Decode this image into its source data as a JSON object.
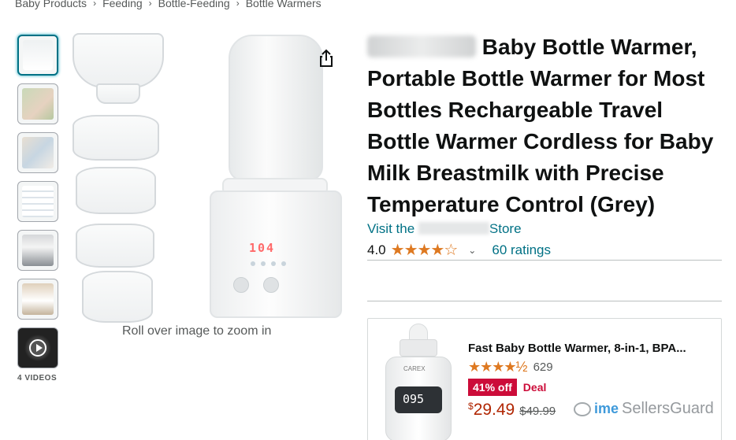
{
  "breadcrumb": [
    "Baby Products",
    "Feeding",
    "Bottle-Feeding",
    "Bottle Warmers"
  ],
  "breadcrumb_sep": "›",
  "thumbnails": [
    "product-main",
    "lifestyle-family",
    "lifestyle-mother",
    "feature-chart",
    "comparison-table",
    "lifestyle-kitchen",
    "video"
  ],
  "videos_label": "4 VIDEOS",
  "zoom_hint": "Roll over image to zoom in",
  "main_image": {
    "display_value": "104"
  },
  "product": {
    "title_rest": "Baby Bottle Warmer, Portable Bottle Warmer for Most Bottles Rechargeable Travel Bottle Warmer Cordless for Baby Milk Breastmilk with Precise Temperature Control (Grey)",
    "store_prefix": "Visit the",
    "store_suffix": "Store",
    "rating_value": "4.0",
    "stars": "★★★★☆",
    "ratings_link": "60 ratings"
  },
  "sponsored": {
    "title": "Fast Baby Bottle Warmer, 8-in-1, BPA...",
    "stars": "★★★★½",
    "rating_count": "629",
    "brand_on_image": "CAREX",
    "screen_value": "095",
    "deal_badge": "41% off",
    "deal_label": "Deal",
    "price_symbol": "$",
    "price": "29.49",
    "list_price": "$49.99",
    "prime_fragment": "ime"
  },
  "watermark": "SellersGuard",
  "colors": {
    "link": "#007185",
    "star": "#de7921",
    "deal": "#cc0c39",
    "price": "#b12704"
  }
}
